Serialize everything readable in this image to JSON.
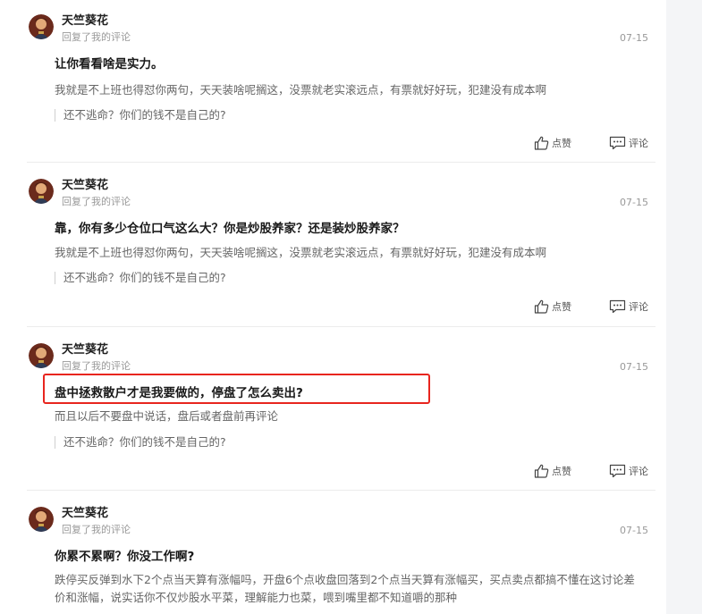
{
  "comments": [
    {
      "nickname": "天竺葵花",
      "subtitle": "回复了我的评论",
      "date": "07-15",
      "reply": "让你看看啥是实力。",
      "quote": "我就是不上班也得怼你两句，天天装啥呢搁这，没票就老实滚远点，有票就好好玩，犯建没有成本啊",
      "original": "还不逃命？你们的钱不是自己的?",
      "like_label": "点赞",
      "comment_label": "评论"
    },
    {
      "nickname": "天竺葵花",
      "subtitle": "回复了我的评论",
      "date": "07-15",
      "reply": "靠，你有多少仓位口气这么大？你是炒股养家？还是装炒股养家？",
      "quote": "我就是不上班也得怼你两句，天天装啥呢搁这，没票就老实滚远点，有票就好好玩，犯建没有成本啊",
      "original": "还不逃命？你们的钱不是自己的?",
      "like_label": "点赞",
      "comment_label": "评论"
    },
    {
      "nickname": "天竺葵花",
      "subtitle": "回复了我的评论",
      "date": "07-15",
      "reply": "盘中拯救散户才是我要做的，停盘了怎么卖出?",
      "quote": "而且以后不要盘中说话，盘后或者盘前再评论",
      "original": "还不逃命？你们的钱不是自己的?",
      "like_label": "点赞",
      "comment_label": "评论"
    },
    {
      "nickname": "天竺葵花",
      "subtitle": "回复了我的评论",
      "date": "07-15",
      "reply": "你累不累啊？你没工作啊?",
      "quote": "跌停买反弹到水下2个点当天算有涨幅吗，开盘6个点收盘回落到2个点当天算有涨幅买，买点卖点都搞不懂在这讨论差价和涨幅，说实话你不仅炒股水平菜，理解能力也菜，喂到嘴里都不知道嚼的那种"
    }
  ],
  "colors": {
    "highlight": "#e8251e",
    "divider": "#ececec",
    "side": "#f4f5f7"
  },
  "icons": {
    "avatar": "avatar-portrait",
    "like": "thumbs-up-icon",
    "comment": "comment-bubble-icon"
  }
}
